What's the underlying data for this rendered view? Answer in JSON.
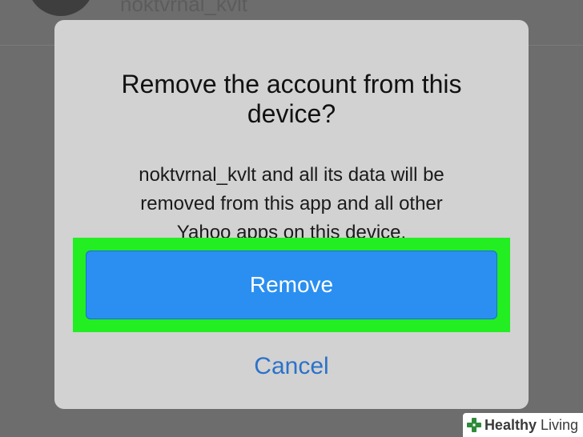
{
  "background": {
    "username": "noktvrnal_kvlt"
  },
  "dialog": {
    "title_line1": "Remove the account from this",
    "title_line2": "device?",
    "message_line1": "noktvrnal_kvlt and all its data will be",
    "message_line2": "removed from this app and all other",
    "message_line3": "Yahoo apps on this device.",
    "remove_label": "Remove",
    "cancel_label": "Cancel"
  },
  "watermark": {
    "brand_bold": "Healthy",
    "brand_light": " Living"
  },
  "colors": {
    "highlight": "#22ee22",
    "remove_button": "#2a8ff0",
    "cancel_text": "#2b72c9",
    "dialog_background": "#d2d2d2"
  }
}
